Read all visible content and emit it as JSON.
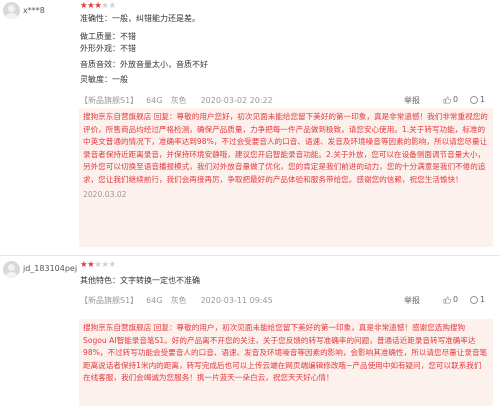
{
  "reviews": [
    {
      "username": "x***8",
      "rating": 3,
      "attrs": [
        "准确性：一般，纠错能力还是差。",
        "做工质量：不错",
        "外形外观：不错",
        "音质音效：外放音量太小，音质不好",
        "灵敏度：一般"
      ],
      "product": "【新品旗舰S1】",
      "capacity": "64G",
      "color": "灰色",
      "date": "2020-03-02 20:22",
      "report": "举报",
      "likes": "0",
      "comments": "1",
      "reply": {
        "text": "搜狗京东自营旗舰店 回复：尊敬的用户您好，初次见面未能给您留下美好的第一印象，真是非常遗憾！我们非常重视您的评价，所售商品均经过严格检测，确保产品质量，力争把每一件产品做到极致，请您安心使用。1.关于转写功能，标准的中英文普通的情况下，准确率达到98%，不过会受要音人的口音、语速、发音及环境噪音等因素的影响，所以请您尽量让录音者保持近距离录音，并保持环境安静哦，建议您开启智能录音功能。2.关于外放，您可以在设备侧面调节音量大小，另外您可以切换至语音播报模式，我们对外放音量做了优化，您的肯定是我们前进的动力，您的十分满意是我们不倦的追求，您让我们继续前行，我们会再接再厉，争取把最好的产品体验和服务带给您。感谢您的信赖，祝您生活愉快！",
        "date": "2020.03.02"
      }
    },
    {
      "username": "jd_183104pej",
      "rating": 2,
      "attrs": [
        "其他特色：文字转换一定也不准确"
      ],
      "product": "【新品旗舰S1】",
      "capacity": "64G",
      "color": "灰色",
      "date": "2020-03-11 09:45",
      "report": "举报",
      "likes": "0",
      "comments": "1",
      "reply": {
        "text": "搜狗京东自营旗舰店 回复：尊敬的用户，初次见面未能给您留下美好的第一印象，真是非常遗憾！感谢您选购搜狗 Sogou AI智能录音笔S1。好的产品离不开您的关注，关于您反馈的转写准确率的问题，普通话近距录音转写准确率达 98%，不过转写功能会受要音人的口音、语速、发音及环境噪音等因素的影响，会影响其准确性，所以请您尽量让录音笔距离说话者保持1米内的距离，转写完成后也可以上传云端在网页端编辑修改哦~产品使用中如有疑问，您可以联系我们在线客服，我们会竭诚为您服务！携一片蓝天一朵白云，祝您天天好心情！",
        "date": ""
      }
    }
  ],
  "colors": {
    "accent": "#e4393c",
    "reply_bg": "#fdf1ee",
    "meta": "#999999"
  },
  "icons": {
    "like": "thumbs-up-icon",
    "comment": "comment-bubble-icon"
  }
}
